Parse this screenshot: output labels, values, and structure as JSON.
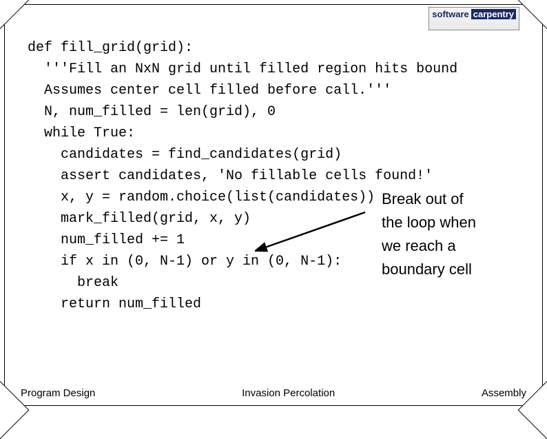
{
  "logo": {
    "top": "",
    "word1": "software",
    "word2": "carpentry"
  },
  "code": {
    "lines": [
      "def fill_grid(grid):",
      "  '''Fill an NxN grid until filled region hits bound",
      "  Assumes center cell filled before call.'''",
      "  N, num_filled = len(grid), 0",
      "  while True:",
      "    candidates = find_candidates(grid)",
      "    assert candidates, 'No fillable cells found!'",
      "    x, y = random.choice(list(candidates))",
      "    mark_filled(grid, x, y)",
      "    num_filled += 1",
      "    if x in (0, N-1) or y in (0, N-1):",
      "      break",
      "    return num_filled"
    ]
  },
  "annotation": {
    "l1": "Break out of",
    "l2": "the loop when",
    "l3": "we reach a",
    "l4": "boundary cell"
  },
  "footer": {
    "left": "Program Design",
    "center": "Invasion Percolation",
    "right": "Assembly"
  }
}
